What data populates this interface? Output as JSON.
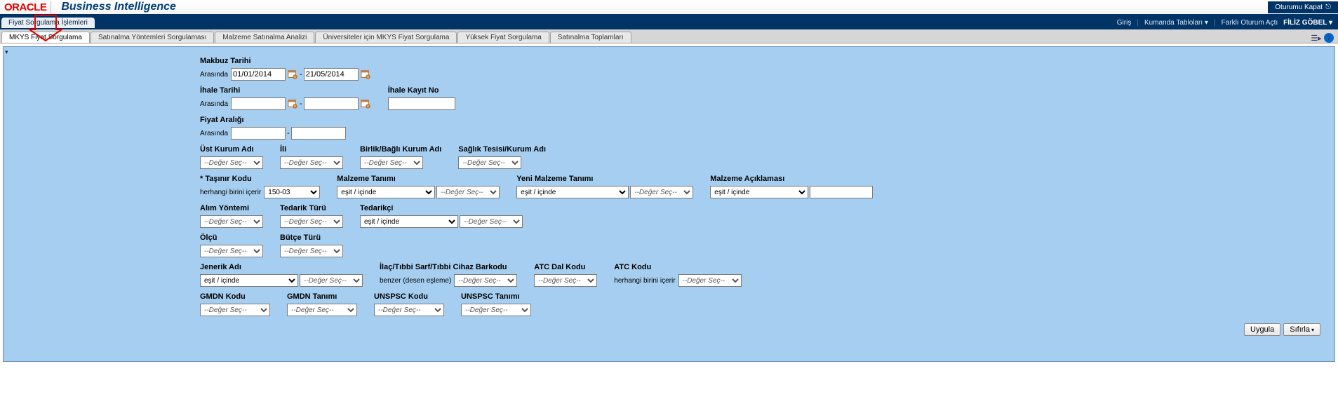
{
  "header": {
    "logo": "ORACLE",
    "title": "Business Intelligence",
    "logout": "Oturumu Kapat"
  },
  "nav2": {
    "active_tab": "Fiyat Sorgulama İşlemleri",
    "links": {
      "home": "Giriş",
      "dashboards": "Kumanda Tabloları",
      "acted_as": "Farklı Oturum Açtı",
      "user": "FİLİZ GÖBEL"
    }
  },
  "tabs": [
    "MKYS Fiyat Sorgulama",
    "Satınalma Yöntemleri Sorgulaması",
    "Malzeme Satınalma Analizi",
    "Üniversiteler için MKYS Fiyat Sorgulama",
    "Yüksek Fiyat Sorgulama",
    "Satınalma Toplamları"
  ],
  "form": {
    "makbuz_tarihi": {
      "label": "Makbuz Tarihi",
      "prefix": "Arasında",
      "from": "01/01/2014",
      "to": "21/05/2014"
    },
    "ihale_tarihi": {
      "label": "İhale Tarihi",
      "prefix": "Arasında",
      "from": "",
      "to": ""
    },
    "ihale_kayit_no": {
      "label": "İhale Kayıt No",
      "value": ""
    },
    "fiyat_araligi": {
      "label": "Fiyat Aralığı",
      "prefix": "Arasında",
      "from": "",
      "to": ""
    },
    "ust_kurum": {
      "label": "Üst Kurum Adı",
      "sel": "--Değer Seç--"
    },
    "ili": {
      "label": "İli",
      "sel": "--Değer Seç--"
    },
    "birlik": {
      "label": "Birlik/Bağlı Kurum Adı",
      "sel": "--Değer Seç--"
    },
    "saglik_tesisi": {
      "label": "Sağlık Tesisi/Kurum Adı",
      "sel": "--Değer Seç--"
    },
    "tasinir": {
      "label": "* Taşınır Kodu",
      "prefix": "herhangi birini içerir",
      "value": "150-03"
    },
    "malzeme_tanimi": {
      "label": "Malzeme Tanımı",
      "op": "eşit / içinde",
      "sel": "--Değer Seç--"
    },
    "yeni_malzeme": {
      "label": "Yeni Malzeme Tanımı",
      "op": "eşit / içinde",
      "sel": "--Değer Seç--"
    },
    "malzeme_aciklama": {
      "label": "Malzeme Açıklaması",
      "op": "eşit / içinde",
      "value": ""
    },
    "alim_yontemi": {
      "label": "Alım Yöntemi",
      "sel": "--Değer Seç--"
    },
    "tedarik_turu": {
      "label": "Tedarik Türü",
      "sel": "--Değer Seç--"
    },
    "tedarikci": {
      "label": "Tedarikçi",
      "op": "eşit / içinde",
      "sel": "--Değer Seç--"
    },
    "olcu": {
      "label": "Ölçü",
      "sel": "--Değer Seç--"
    },
    "butce_turu": {
      "label": "Bütçe Türü",
      "sel": "--Değer Seç--"
    },
    "jenerik": {
      "label": "Jenerik Adı",
      "op": "eşit / içinde",
      "sel": "--Değer Seç--"
    },
    "barkod": {
      "label": "İlaç/Tıbbi Sarf/Tıbbi Cihaz Barkodu",
      "prefix": "benzer (desen eşleme)",
      "sel": "--Değer Seç--"
    },
    "atc_dal": {
      "label": "ATC Dal Kodu",
      "sel": "--Değer Seç--"
    },
    "atc_kodu": {
      "label": "ATC Kodu",
      "prefix": "herhangi birini içerir",
      "sel": "--Değer Seç--"
    },
    "gmdn_kodu": {
      "label": "GMDN Kodu",
      "sel": "--Değer Seç--"
    },
    "gmdn_tanimi": {
      "label": "GMDN Tanımı",
      "sel": "--Değer Seç--"
    },
    "unspsc_kodu": {
      "label": "UNSPSC Kodu",
      "sel": "--Değer Seç--"
    },
    "unspsc_tanimi": {
      "label": "UNSPSC Tanımı",
      "sel": "--Değer Seç--"
    }
  },
  "buttons": {
    "apply": "Uygula",
    "reset": "Sıfırla"
  }
}
